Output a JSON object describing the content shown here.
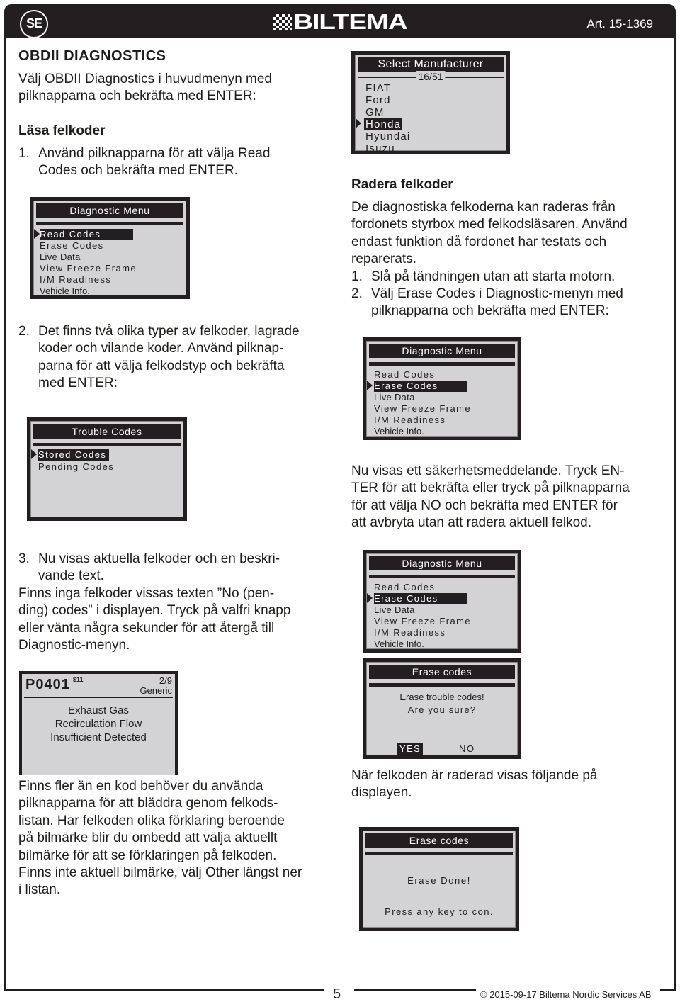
{
  "header": {
    "country_badge": "SE",
    "brand": "BILTEMA",
    "article_number": "Art. 15-1369"
  },
  "left": {
    "title": "OBDII DIAGNOSTICS",
    "intro": [
      "Välj OBDII Diagnostics i huvudmenyn med",
      "pilknapparna och bekräfta med ENTER:"
    ],
    "section_read": "Läsa felkoder",
    "step1": {
      "num": "1.",
      "lines": [
        "Använd pilknapparna för att välja Read",
        "Codes och bekräfta med ENTER."
      ]
    },
    "diag_menu_1": {
      "title": "Diagnostic Menu",
      "items": [
        "Read Codes",
        "Erase Codes",
        "Live Data",
        "View Freeze Frame",
        "I/M Readiness",
        "Vehicle Info."
      ],
      "selected_index": 0
    },
    "step2": {
      "num": "2.",
      "lines": [
        "Det finns två olika typer av felkoder, lagrade",
        "koder och vilande koder. Använd pilknap-",
        "parna för att välja felkodstyp och bekräfta",
        "med ENTER:"
      ]
    },
    "trouble_codes": {
      "title": "Trouble Codes",
      "items": [
        "Stored Codes",
        "Pending Codes"
      ],
      "selected_index": 0
    },
    "step3": {
      "num": "3.",
      "lines": [
        "Nu visas aktuella felkoder och en beskri-",
        "vande text."
      ]
    },
    "step3_cont": [
      "Finns inga felkoder vissas texten ”No (pen-",
      "ding) codes” i displayen. Tryck på valfri knapp",
      "eller vänta några sekunder för att återgå till",
      "Diagnostic-menyn."
    ],
    "code_screen": {
      "code": "P0401",
      "sup": "$11",
      "count": "2/9",
      "type": "Generic",
      "description": [
        "Exhaust Gas",
        "Recirculation Flow",
        "Insufficient Detected"
      ]
    },
    "more_codes": [
      "Finns fler än en kod behöver du använda",
      "pilknapparna för att bläddra genom felkods-",
      "listan. Har felkoden olika förklaring beroende",
      "på bilmärke blir du ombedd att välja aktuellt",
      "bilmärke för att se förklaringen på felkoden.",
      "Finns inte aktuell bilmärke, välj Other längst ner",
      "i listan."
    ]
  },
  "right": {
    "manufacturer_screen": {
      "title": "Select Manufacturer",
      "count": "16/51",
      "items": [
        "FIAT",
        "Ford",
        "GM",
        "Honda",
        "Hyundai",
        "Isuzu"
      ],
      "selected_index": 3
    },
    "section_erase": "Radera felkoder",
    "erase_intro": [
      "De diagnostiska felkoderna kan raderas från",
      "fordonets styrbox med felkodsläsaren. Använd",
      "endast funktion då fordonet har testats och",
      "reparerats."
    ],
    "step1": {
      "num": "1.",
      "lines": [
        "Slå på tändningen utan att starta motorn."
      ]
    },
    "step2": {
      "num": "2.",
      "lines": [
        "Välj Erase Codes i Diagnostic-menyn med",
        "pilknapparna och bekräfta med ENTER:"
      ]
    },
    "diag_menu_2": {
      "title": "Diagnostic Menu",
      "items": [
        "Read Codes",
        "Erase Codes",
        "Live Data",
        "View Freeze Frame",
        "I/M Readiness",
        "Vehicle Info."
      ],
      "selected_index": 1
    },
    "safety_text": [
      "Nu visas ett säkerhetsmeddelande. Tryck EN-",
      "TER för att bekräfta eller tryck på pilknapparna",
      "för att välja NO och bekräfta med ENTER för",
      "att avbryta utan att radera aktuell felkod."
    ],
    "diag_menu_3": {
      "title": "Diagnostic Menu",
      "items": [
        "Read Codes",
        "Erase Codes",
        "Live Data",
        "View Freeze Frame",
        "I/M Readiness",
        "Vehicle Info."
      ],
      "selected_index": 1
    },
    "confirm_screen": {
      "title": "Erase codes",
      "lines": [
        "Erase trouble codes!",
        "Are you sure?"
      ],
      "yes": "YES",
      "no": "NO"
    },
    "done_text": [
      "När felkoden är raderad visas följande på",
      "displayen."
    ],
    "done_screen": {
      "title": "Erase codes",
      "message": "Erase Done!",
      "prompt": "Press any key to con."
    }
  },
  "footer": {
    "page_number": "5",
    "copyright": "© 2015-09-17 Biltema Nordic Services AB"
  }
}
